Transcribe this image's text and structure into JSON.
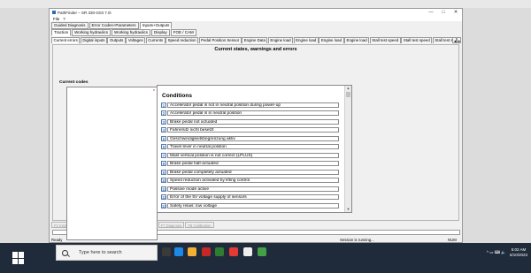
{
  "window": {
    "title": "PathFinder – SR 330-G03 7.0i",
    "menu": [
      "File",
      "?"
    ],
    "controls": [
      "—",
      "□",
      "✕"
    ]
  },
  "tabs_level1": [
    "Guided Diagnosis",
    "Error Codes+Parameters",
    "Inputs+Outputs"
  ],
  "tabs_level1_active": 2,
  "tabs_level2": [
    "Traction",
    "Working hydraulics",
    "Working hydraulics",
    "Display",
    "FOE / CAM"
  ],
  "tabs_level2_active": 0,
  "tabs_level3": [
    "Current errors",
    "Digital inputs",
    "Outputs",
    "Voltages",
    "Currents",
    "Speed reduction",
    "Pedal Position Sensor",
    "Engine Data",
    "Engine load",
    "Engine load",
    "Engine load",
    "Engine load",
    "Stall test speed",
    "Stall test speed",
    "Stall test sp"
  ],
  "tabs_level3_active": 0,
  "tab_scroll": [
    "◄",
    "►"
  ],
  "section_title": "Current states, warnings and errors",
  "current_codes": {
    "label": "Current codes",
    "marker": "*"
  },
  "conditions": {
    "title": "Conditions",
    "rows": [
      {
        "num": "1",
        "text": "Accelerator pedal is not in neutral position during power-up"
      },
      {
        "num": "2",
        "text": "Accelerator pedal is in neutral position"
      },
      {
        "num": "3",
        "text": "Brake pedal not actuated"
      },
      {
        "num": "4",
        "text": "Fahrersitz nicht besetzt"
      },
      {
        "num": "5",
        "text": "Geschwindigkeitsbegrenzung aktiv"
      },
      {
        "num": "6",
        "text": "Travel lever in neutral position"
      },
      {
        "num": "7",
        "text": "Mast vertical position is not correct (LPLUS)"
      },
      {
        "num": "8",
        "text": "Brake pedal half-actuated"
      },
      {
        "num": "9",
        "text": "Brake pedal completely actuated"
      },
      {
        "num": "10",
        "text": "Speed reduction activated by lifting control"
      },
      {
        "num": "11",
        "text": "Passive mode active"
      },
      {
        "num": "12",
        "text": "Error of the 5V voltage supply of sensors"
      },
      {
        "num": "13",
        "text": "Safety relais: low voltage"
      }
    ]
  },
  "scrollbar": {
    "up": "▲",
    "down": "▼"
  },
  "fkeys": [
    {
      "label": "F2 Instruction",
      "enabled": false
    },
    {
      "label": "F3 Stop",
      "enabled": true
    },
    {
      "label": "F4 Load",
      "enabled": false
    },
    {
      "label": "F5 Save",
      "enabled": false
    },
    {
      "label": "F6 Print",
      "enabled": false
    },
    {
      "label": "F7 Diagnose",
      "enabled": false
    },
    {
      "label": "F8 Calibration",
      "enabled": false
    }
  ],
  "status": {
    "left": "Ready",
    "mid": "Session is running...",
    "right": "NUM"
  },
  "taskbar": {
    "search_placeholder": "Type here to search",
    "time": "5:02 AM",
    "date": "6/10/2023",
    "tray_text": "^  ▭  ⌨  🔈"
  },
  "colors": {
    "taskbar": "#1f2a3a",
    "accent": "#2b6bb5",
    "row_number_border": "#5b7fb0"
  }
}
